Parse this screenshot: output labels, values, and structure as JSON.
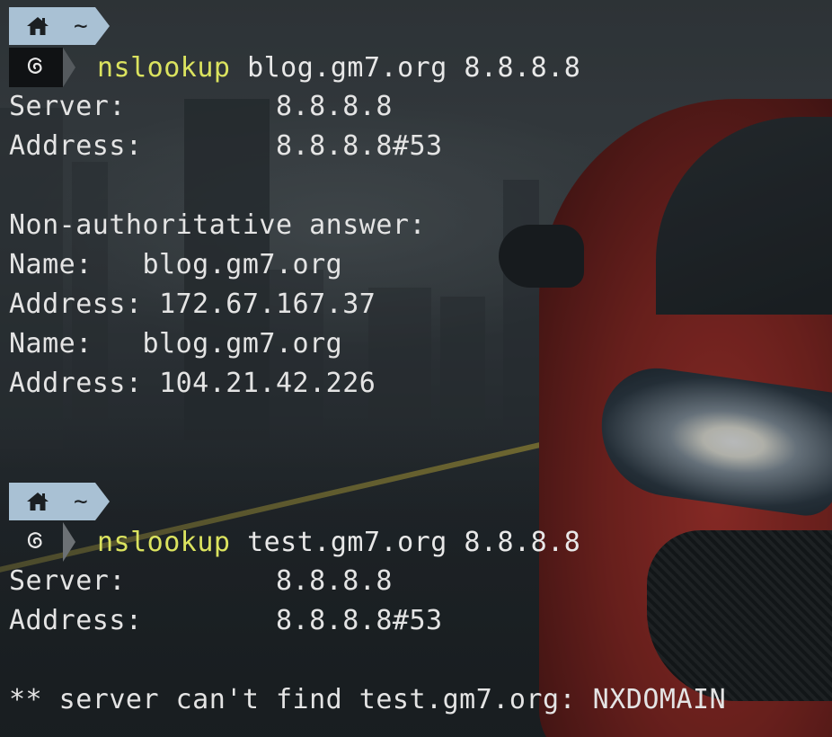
{
  "prompt1": {
    "dir": "~",
    "command_keyword": "nslookup",
    "command_args": "blog.gm7.org 8.8.8.8"
  },
  "output1": {
    "server_label": "Server:",
    "server_value": "8.8.8.8",
    "address_label": "Address:",
    "address_value": "8.8.8.8#53",
    "answer_header": "Non-authoritative answer:",
    "records": [
      {
        "label": "Name:",
        "value": "blog.gm7.org"
      },
      {
        "label": "Address:",
        "value": "172.67.167.37"
      },
      {
        "label": "Name:",
        "value": "blog.gm7.org"
      },
      {
        "label": "Address:",
        "value": "104.21.42.226"
      }
    ]
  },
  "prompt2": {
    "dir": "~",
    "command_keyword": "nslookup",
    "command_args": "test.gm7.org 8.8.8.8"
  },
  "output2": {
    "server_label": "Server:",
    "server_value": "8.8.8.8",
    "address_label": "Address:",
    "address_value": "8.8.8.8#53",
    "error": "** server can't find test.gm7.org: NXDOMAIN"
  },
  "icons": {
    "home": "home-icon",
    "os": "debian-swirl-icon"
  },
  "colors": {
    "prompt_segment": "#a9c1d4",
    "command_keyword": "#dbe35f",
    "text": "#e4e4e4"
  }
}
